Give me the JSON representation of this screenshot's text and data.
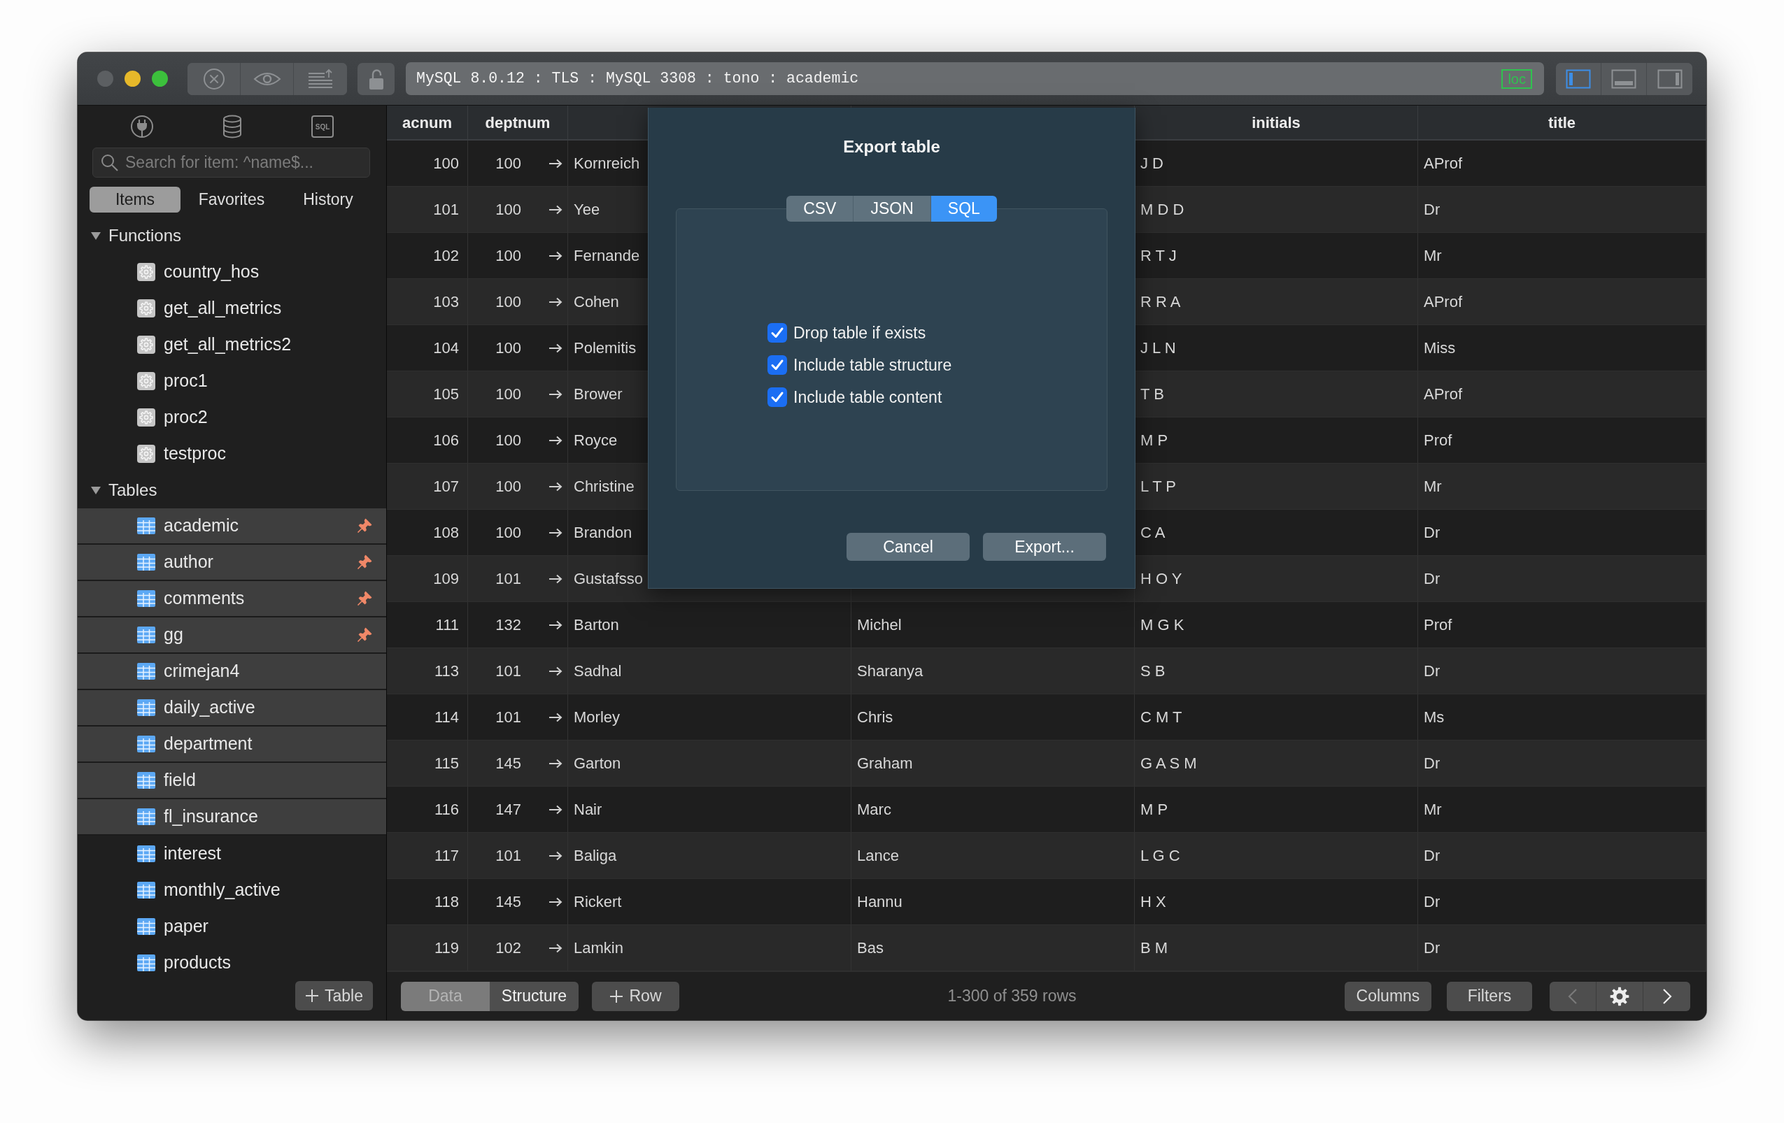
{
  "window": {
    "traffic_lights": [
      {
        "kind": "close",
        "disabled": true
      },
      {
        "kind": "minimize",
        "disabled": false
      },
      {
        "kind": "zoom",
        "disabled": false
      }
    ],
    "connection": "MySQL 8.0.12 : TLS : MySQL 3308 : tono : academic",
    "connection_tag": "loc",
    "panel_toggles": [
      {
        "kind": "left",
        "on": true
      },
      {
        "kind": "bottom",
        "on": false
      },
      {
        "kind": "right",
        "on": false
      }
    ]
  },
  "sidebar": {
    "sql_icon_text": "SQL",
    "search": {
      "placeholder": "Search for item: ^name$..."
    },
    "tabs": [
      {
        "label": "Items",
        "selected": true
      },
      {
        "label": "Favorites",
        "selected": false
      },
      {
        "label": "History",
        "selected": false
      }
    ],
    "tree": [
      {
        "label": "Functions",
        "expanded": true,
        "children": [
          {
            "label": "country_hos",
            "kind": "function",
            "selected": false
          },
          {
            "label": "get_all_metrics",
            "kind": "function",
            "selected": false
          },
          {
            "label": "get_all_metrics2",
            "kind": "function",
            "selected": false
          },
          {
            "label": "proc1",
            "kind": "function",
            "selected": false
          },
          {
            "label": "proc2",
            "kind": "function",
            "selected": false
          },
          {
            "label": "testproc",
            "kind": "function",
            "selected": false
          }
        ]
      },
      {
        "label": "Tables",
        "expanded": true,
        "children": [
          {
            "label": "academic",
            "kind": "table",
            "selected": true,
            "pinned": true
          },
          {
            "label": "author",
            "kind": "table",
            "selected": true,
            "pinned": true
          },
          {
            "label": "comments",
            "kind": "table",
            "selected": true,
            "pinned": true
          },
          {
            "label": "gg",
            "kind": "table",
            "selected": true,
            "pinned": true
          },
          {
            "label": "crimejan4",
            "kind": "table",
            "selected": true,
            "pinned": false
          },
          {
            "label": "daily_active",
            "kind": "table",
            "selected": true,
            "pinned": false
          },
          {
            "label": "department",
            "kind": "table",
            "selected": true,
            "pinned": false
          },
          {
            "label": "field",
            "kind": "table",
            "selected": true,
            "pinned": false
          },
          {
            "label": "fl_insurance",
            "kind": "table",
            "selected": true,
            "pinned": false
          },
          {
            "label": "interest",
            "kind": "table",
            "selected": false,
            "pinned": false
          },
          {
            "label": "monthly_active",
            "kind": "table",
            "selected": false,
            "pinned": false
          },
          {
            "label": "paper",
            "kind": "table",
            "selected": false,
            "pinned": false
          },
          {
            "label": "products",
            "kind": "table",
            "selected": false,
            "pinned": false
          }
        ]
      }
    ],
    "add_button": "Table"
  },
  "table": {
    "headers": {
      "acnum": "acnum",
      "deptnum": "deptnum",
      "initials": "initials",
      "title": "title"
    },
    "rows": [
      {
        "acnum": "100",
        "deptnum": "100",
        "column_3": "Kornreich",
        "initials": "J D",
        "title": "AProf"
      },
      {
        "acnum": "101",
        "deptnum": "100",
        "column_3": "Yee",
        "initials": "M D D",
        "title": "Dr"
      },
      {
        "acnum": "102",
        "deptnum": "100",
        "column_3": "Fernande",
        "initials": "R T J",
        "title": "Mr"
      },
      {
        "acnum": "103",
        "deptnum": "100",
        "column_3": "Cohen",
        "initials": "R R A",
        "title": "AProf"
      },
      {
        "acnum": "104",
        "deptnum": "100",
        "column_3": "Polemitis",
        "initials": "J L N",
        "title": "Miss"
      },
      {
        "acnum": "105",
        "deptnum": "100",
        "column_3": "Brower",
        "initials": "T B",
        "title": "AProf"
      },
      {
        "acnum": "106",
        "deptnum": "100",
        "column_3": "Royce",
        "initials": "M P",
        "title": "Prof"
      },
      {
        "acnum": "107",
        "deptnum": "100",
        "column_3": "Christine",
        "initials": "L T P",
        "title": "Mr"
      },
      {
        "acnum": "108",
        "deptnum": "100",
        "column_3": "Brandon",
        "initials": "C A",
        "title": "Dr"
      },
      {
        "acnum": "109",
        "deptnum": "101",
        "column_3": "Gustafsso",
        "initials": "H O Y",
        "title": "Dr"
      },
      {
        "acnum": "111",
        "deptnum": "132",
        "column_3": "Barton",
        "column_4": "Michel",
        "initials": "M G K",
        "title": "Prof"
      },
      {
        "acnum": "113",
        "deptnum": "101",
        "column_3": "Sadhal",
        "column_4": "Sharanya",
        "initials": "S B",
        "title": "Dr"
      },
      {
        "acnum": "114",
        "deptnum": "101",
        "column_3": "Morley",
        "column_4": "Chris",
        "initials": "C M T",
        "title": "Ms"
      },
      {
        "acnum": "115",
        "deptnum": "145",
        "column_3": "Garton",
        "column_4": "Graham",
        "initials": "G A S M",
        "title": "Dr"
      },
      {
        "acnum": "116",
        "deptnum": "147",
        "column_3": "Nair",
        "column_4": "Marc",
        "initials": "M P",
        "title": "Mr"
      },
      {
        "acnum": "117",
        "deptnum": "101",
        "column_3": "Baliga",
        "column_4": "Lance",
        "initials": "L G C",
        "title": "Dr"
      },
      {
        "acnum": "118",
        "deptnum": "145",
        "column_3": "Rickert",
        "column_4": "Hannu",
        "initials": "H X",
        "title": "Dr"
      },
      {
        "acnum": "119",
        "deptnum": "102",
        "column_3": "Lamkin",
        "column_4": "Bas",
        "initials": "B M",
        "title": "Dr"
      }
    ]
  },
  "dialog": {
    "title": "Export table",
    "formats": [
      {
        "label": "CSV",
        "selected": false
      },
      {
        "label": "JSON",
        "selected": false
      },
      {
        "label": "SQL",
        "selected": true
      }
    ],
    "options": [
      {
        "label": "Drop table if exists",
        "checked": true
      },
      {
        "label": "Include table structure",
        "checked": true
      },
      {
        "label": "Include table content",
        "checked": true
      }
    ],
    "buttons": [
      "Cancel",
      "Export..."
    ]
  },
  "footer": {
    "views": [
      {
        "label": "Data",
        "selected": true
      },
      {
        "label": "Structure",
        "selected": false
      }
    ],
    "add_row": "Row",
    "row_count": "1-300 of 359 rows",
    "buttons": [
      {
        "kind": "columns",
        "label": "Columns"
      },
      {
        "kind": "filters",
        "label": "Filters"
      }
    ],
    "pager": [
      {
        "kind": "previous",
        "disabled": true
      },
      {
        "kind": "settings",
        "disabled": false
      },
      {
        "kind": "next",
        "disabled": false
      }
    ]
  }
}
